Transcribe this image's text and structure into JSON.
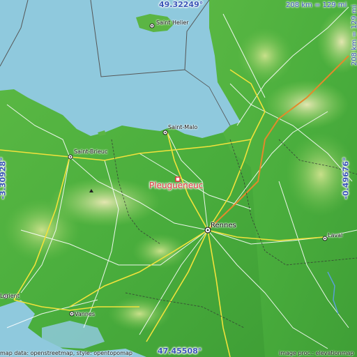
{
  "map": {
    "coords": {
      "north": "49.32249°",
      "south": "47.45508°",
      "west": "-3.30928°",
      "east": "-0.49676°"
    },
    "scale_top": "208 km = 129 mi",
    "scale_right": "208 km = 129 mi",
    "main_place": "Pleugueneuc",
    "places": {
      "saint_helier": "Saint Helier",
      "saint_malo": "Saint-Malo",
      "saint_brieuc": "Saint-Brieuc",
      "rennes": "Rennes",
      "laval": "Laval",
      "vannes": "Vannes",
      "lorient": "Lorient"
    },
    "credit_left": "map data: openstreetmap, style: opentopomap",
    "credit_right": "image proc.: elevationmap",
    "colors": {
      "sea": "#8fc9dd",
      "land_low": "#3fa83a",
      "land_mid": "#8fcf5e",
      "land_high": "#d8e3a0",
      "road_main": "#f2e23b",
      "road_secondary": "#ffffff",
      "border": "#555555",
      "marker": "#e0323a",
      "coord_text": "#3b56b8"
    }
  }
}
